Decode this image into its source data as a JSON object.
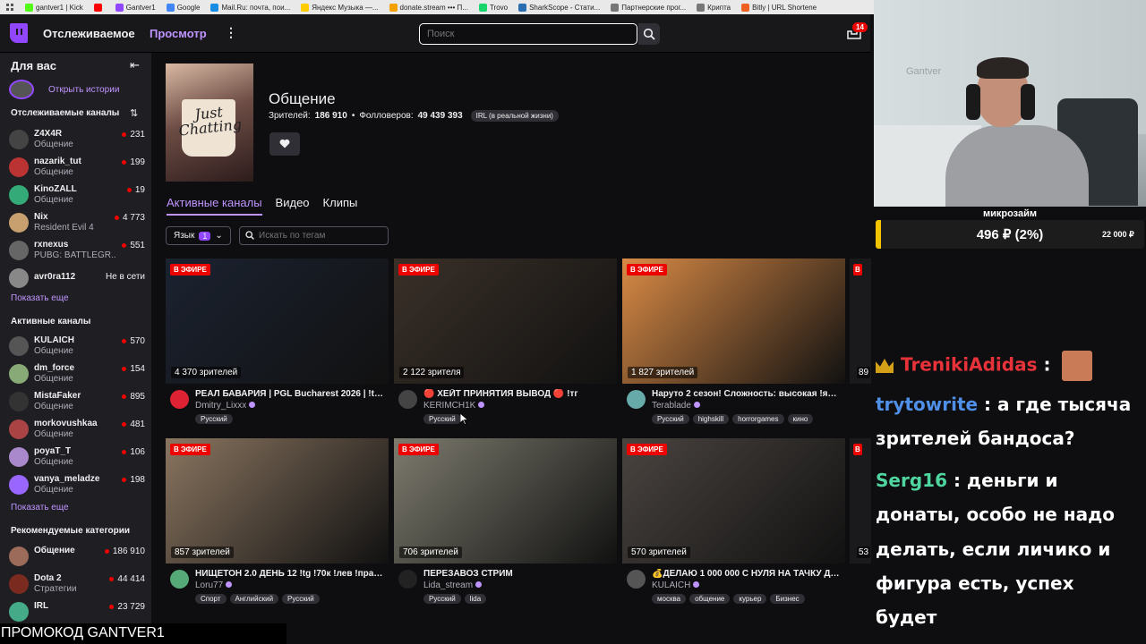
{
  "bookmarks": [
    {
      "label": "gantver1 | Kick",
      "color": "#53fc18"
    },
    {
      "label": "",
      "color": "#ff0000"
    },
    {
      "label": "Gantver1",
      "color": "#9147ff"
    },
    {
      "label": "Google",
      "color": "#4285f4"
    },
    {
      "label": "Mail.Ru: почта, пои...",
      "color": "#168de2"
    },
    {
      "label": "Яндекс Музыка —...",
      "color": "#ffcc00"
    },
    {
      "label": "donate.stream ••• П...",
      "color": "#f4a100"
    },
    {
      "label": "Trovo",
      "color": "#19d66b"
    },
    {
      "label": "SharkScope - Стати...",
      "color": "#2a6db0"
    },
    {
      "label": "Партнерские прог...",
      "color": "#777777"
    },
    {
      "label": "Крипта",
      "color": "#777777"
    },
    {
      "label": "Bitly | URL Shortene",
      "color": "#ee6123"
    }
  ],
  "topnav": {
    "following": "Отслеживаемое",
    "browse": "Просмотр",
    "more": "⋮",
    "search_placeholder": "Поиск",
    "inbox_count": "14"
  },
  "sidebar": {
    "title": "Для вас",
    "stories_label": "Открыть истории",
    "followed_title": "Отслеживаемые каналы",
    "followed": [
      {
        "name": "Z4X4R",
        "game": "Общение",
        "viewers": "231",
        "color": "#444"
      },
      {
        "name": "nazarik_tut",
        "game": "Общение",
        "viewers": "199",
        "color": "#b33"
      },
      {
        "name": "KinoZALL",
        "game": "Общение",
        "viewers": "19",
        "color": "#3a7"
      },
      {
        "name": "Nix",
        "game": "Resident Evil 4",
        "viewers": "4 773",
        "color": "#c8a070"
      },
      {
        "name": "rxnexus",
        "game": "PUBG: BATTLEGR...",
        "viewers": "551",
        "color": "#666"
      },
      {
        "name": "avr0ra112",
        "game": "",
        "viewers": "Не в сети",
        "color": "#888"
      }
    ],
    "show_more_1": "Показать еще",
    "active_title": "Активные каналы",
    "active": [
      {
        "name": "KULAICH",
        "game": "Общение",
        "viewers": "570",
        "color": "#555"
      },
      {
        "name": "dm_force",
        "game": "Общение",
        "viewers": "154",
        "color": "#8a7"
      },
      {
        "name": "MistaFaker",
        "game": "Общение",
        "viewers": "895",
        "color": "#333"
      },
      {
        "name": "morkovushkaa",
        "game": "Общение",
        "viewers": "481",
        "color": "#a44"
      },
      {
        "name": "poyaT_T",
        "game": "Общение",
        "viewers": "106",
        "color": "#a8c"
      },
      {
        "name": "vanya_meladze",
        "game": "Общение",
        "viewers": "198",
        "color": "#96f"
      }
    ],
    "show_more_2": "Показать еще",
    "rec_title": "Рекомендуемые категории",
    "recommended": [
      {
        "name": "Общение",
        "game": "",
        "viewers": "186 910",
        "color": "#9c6b5a"
      },
      {
        "name": "Dota 2",
        "game": "Стратегии",
        "viewers": "44 414",
        "color": "#7a2a1e"
      },
      {
        "name": "IRL",
        "game": "",
        "viewers": "23 729",
        "color": "#4a8"
      }
    ]
  },
  "category": {
    "boxart_text": "Just Chatting",
    "title": "Общение",
    "viewers_label": "Зрителей:",
    "viewers": "186 910",
    "followers_label": "Фолловеров:",
    "followers": "49 439 393",
    "tag": "IRL (в реальной жизни)"
  },
  "tabs": [
    "Активные каналы",
    "Видео",
    "Клипы"
  ],
  "filters": {
    "language_label": "Язык",
    "language_count": "1",
    "tag_search_placeholder": "Искать по тегам"
  },
  "live_badge": "В ЭФИРЕ",
  "streams": [
    {
      "viewers": "4 370 зрителей",
      "title": "РЕАЛ БАВАРИЯ | PGL Bucharest 2026 | !tg !...",
      "channel": "Dmitry_Lixxx",
      "tags": [
        "Русский"
      ],
      "thumb": "#1b2230",
      "avatar": "#d23"
    },
    {
      "viewers": "2 122 зрителя",
      "title": "🔴 ХЕЙТ ПРИНЯТИЯ ВЫВОД 🔴 !тг",
      "channel": "KERIMCH1K",
      "tags": [
        "Русский"
      ],
      "thumb": "#3a3028",
      "avatar": "#444"
    },
    {
      "viewers": "1 827 зрителей",
      "title": "Наруто 2 сезон! Сложность: высокая !янде...",
      "channel": "Terablade",
      "tags": [
        "Русский",
        "highskill",
        "horrorgames",
        "кино"
      ],
      "thumb": "#d98a45",
      "avatar": "#6aa"
    },
    {
      "viewers": "857 зрителей",
      "title": "НИЩЕТОН 2.0 ДЕНЬ 12 !tg !70к !лев !прави...",
      "channel": "Loru77",
      "tags": [
        "Спорт",
        "Английский",
        "Русский"
      ],
      "thumb": "#8a7560",
      "avatar": "#5a7"
    },
    {
      "viewers": "706 зрителей",
      "title": "ПЕРЕЗАВОЗ СТРИМ",
      "channel": "Lida_stream",
      "tags": [
        "Русский",
        "lida"
      ],
      "thumb": "#7d7b6e",
      "avatar": "#222"
    },
    {
      "viewers": "570 зрителей",
      "title": "💰ДЕЛАЮ 1 000 000 С НУЛЯ НА ТАЧКУ ДЕ...",
      "channel": "KULAICH",
      "tags": [
        "москва",
        "общение",
        "курьер",
        "Бизнес"
      ],
      "thumb": "#4a4440",
      "avatar": "#555"
    }
  ],
  "peek": [
    {
      "viewers": "89"
    },
    {
      "viewers": "53"
    }
  ],
  "cam_overlay": {
    "watermark": "Gantver",
    "goal_title": "микрозайм",
    "goal_amount": "496 ₽ (2%)",
    "goal_target": "22 000 ₽",
    "goal_fraction": 0.02
  },
  "chat": [
    {
      "user": "TrenikiAdidas",
      "color": "#e8323a",
      "text": ""
    },
    {
      "user": "trytowrite",
      "color": "#4f8fe8",
      "text": "а где тысяча"
    },
    {
      "user": "",
      "color": "",
      "text": "зрителей бандоса?"
    },
    {
      "user": "Serg16",
      "color": "#4fd6a0",
      "text": "деньги и"
    },
    {
      "user": "",
      "color": "",
      "text": "донаты, особо не надо"
    },
    {
      "user": "",
      "color": "",
      "text": "делать, если личико и"
    },
    {
      "user": "",
      "color": "",
      "text": "фигура есть, успех"
    },
    {
      "user": "",
      "color": "",
      "text": "будет"
    }
  ],
  "promo": "ПРОМОКОД GANTVER1"
}
